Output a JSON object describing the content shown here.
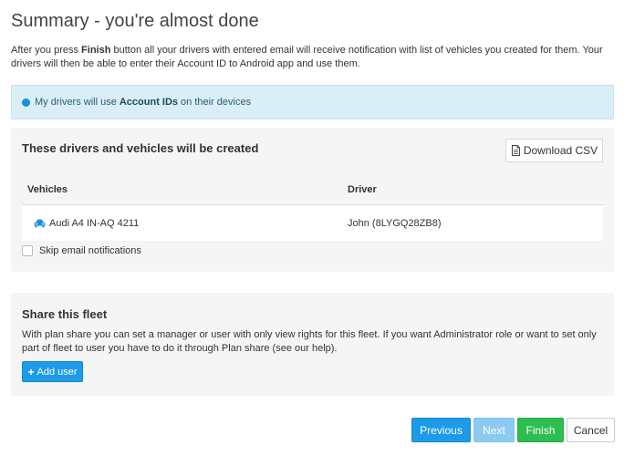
{
  "page": {
    "title": "Summary - you're almost done",
    "intro": {
      "part1": "After you press ",
      "finish_word": "Finish",
      "part2": " button all your drivers with entered email will receive notification with list of vehicles you created for them. Your drivers will then be able to enter their Account ID to Android app and use them."
    }
  },
  "info": {
    "prefix": "My drivers will use",
    "bold": "Account IDs",
    "suffix": "on their devices"
  },
  "drivers_panel": {
    "title": "These drivers and vehicles will be created",
    "download_csv_label": "Download CSV",
    "columns": {
      "vehicles": "Vehicles",
      "driver": "Driver"
    },
    "rows": [
      {
        "vehicle": "Audi A4 IN-AQ 4211",
        "driver": "John (8LYGQ28ZB8)"
      }
    ],
    "skip_email_label": "Skip email notifications"
  },
  "share_panel": {
    "title": "Share this fleet",
    "description": "With plan share you can set a manager or user with only view rights for this fleet. If you want Administrator role or want to set only part of fleet to user you have to do it through Plan share (see our help).",
    "add_user_label": "Add user"
  },
  "footer": {
    "previous_label": "Previous",
    "next_label": "Next",
    "finish_label": "Finish",
    "cancel_label": "Cancel"
  },
  "icons": {
    "info": "info-dot-icon",
    "csv": "document-icon",
    "car": "car-icon",
    "plus": "plus-icon"
  },
  "colors": {
    "primary": "#1d9be8",
    "success": "#2cbe4e",
    "info_bg": "#d9eef6"
  }
}
